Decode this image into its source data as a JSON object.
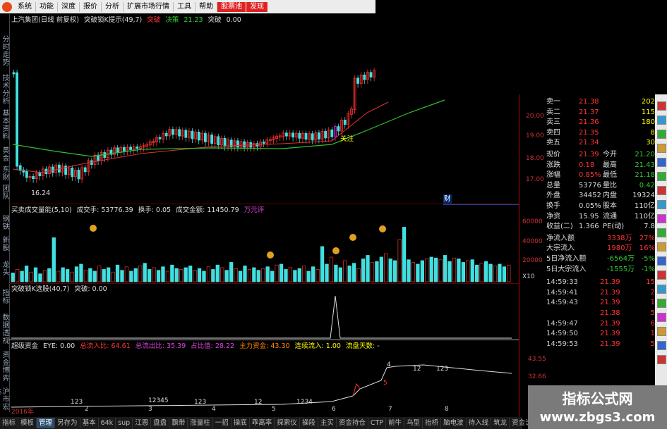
{
  "menu": {
    "items": [
      "系统",
      "功能",
      "深度",
      "报价",
      "分析",
      "扩展市场行情",
      "工具",
      "帮助",
      "股票池",
      "发现"
    ]
  },
  "left_tabs": [
    "分时走势",
    "技术分析",
    "基本资料",
    "黄金",
    "东财",
    "团队",
    "钢铁",
    "新股",
    "龙头",
    "指标",
    "数据透视",
    "资金博弈",
    "沪市宏达",
    "深"
  ],
  "kline": {
    "header": [
      "上汽集团(日线 前复权)",
      "突破锁K提示(49,7)",
      "突破",
      "决策",
      "21.23",
      "突破",
      "0.00"
    ],
    "low_label": "16.24",
    "mark_label": "关注",
    "y_ticks": [
      "20.00",
      "19.00",
      "18.00",
      "17.00"
    ],
    "colors": {
      "up": "#ff3030",
      "down": "#40e0e0",
      "ma_short": "#e03030",
      "ma_long": "#30c030",
      "magenta": "#d020d0"
    },
    "short_label": "财"
  },
  "volume": {
    "header": [
      "买卖成交量能(5,10)",
      "成交手: 53776.39",
      "换手: 0.05",
      "成交金额: 11450.79",
      "万元评"
    ],
    "y_ticks": [
      "60000",
      "40000",
      "20000"
    ],
    "unit": "X10",
    "values": [
      10,
      14,
      12,
      18,
      11,
      16,
      9,
      13,
      15,
      50,
      12,
      16,
      14,
      11,
      17,
      20,
      13,
      15,
      12,
      18,
      14,
      16,
      11,
      19,
      13,
      17,
      12,
      15,
      18,
      21,
      14,
      16,
      13,
      17,
      12,
      19,
      15,
      14,
      16,
      18,
      13,
      15,
      12,
      17,
      14,
      19,
      16,
      13,
      22,
      15,
      12,
      18,
      14,
      16,
      13,
      15,
      17,
      12,
      19,
      20,
      14,
      16,
      13,
      15,
      18,
      12,
      17,
      14,
      40,
      20,
      28,
      19,
      16,
      24,
      18,
      21,
      15,
      26,
      30,
      22,
      23,
      28,
      32,
      26,
      24,
      48,
      62,
      25,
      22,
      20,
      24,
      26,
      28,
      27,
      25,
      30,
      23,
      27,
      26,
      22,
      24,
      25,
      19,
      21,
      23,
      20,
      18,
      20,
      17,
      19
    ]
  },
  "signal": {
    "header": [
      "突破锁K选股(40,7)",
      "突破: 0.00"
    ]
  },
  "capital": {
    "header": [
      "超级资金",
      "EYE: 0.00",
      "总流入比: 64.61",
      "总流出比: 35.39",
      "占比值: 28.22",
      "主力资金: 43.30",
      "连续流入: 1.00",
      "流盘天数: -"
    ],
    "y_ticks": [
      "43.55",
      "32.66"
    ],
    "date_label": "2016年",
    "month_labels": [
      "2",
      "3",
      "4",
      "5",
      "6",
      "7",
      "8"
    ],
    "digit_labels": [
      "123",
      "12345",
      "123",
      "1234",
      "12",
      "123",
      "12",
      "4",
      "5"
    ]
  },
  "order_book": {
    "asks": [
      {
        "label": "卖一",
        "price": "21.38",
        "vol": "202"
      },
      {
        "label": "卖二",
        "price": "21.37",
        "vol": "115"
      },
      {
        "label": "卖三",
        "price": "21.36",
        "vol": "180"
      },
      {
        "label": "卖四",
        "price": "21.35",
        "vol": "8"
      },
      {
        "label": "卖五",
        "price": "21.34",
        "vol": "30"
      }
    ],
    "stats": [
      {
        "l1": "现价",
        "v1": "21.39",
        "l2": "今开",
        "v2": "21.20"
      },
      {
        "l1": "涨跌",
        "v1": "0.18",
        "l2": "最高",
        "v2": "21.43"
      },
      {
        "l1": "涨幅",
        "v1": "0.85%",
        "l2": "最低",
        "v2": "21.18"
      },
      {
        "l1": "总量",
        "v1": "53776",
        "l2": "量比",
        "v2": "0.42"
      },
      {
        "l1": "外盘",
        "v1": "34452",
        "l2": "内盘",
        "v2": "19324"
      },
      {
        "l1": "换手",
        "v1": "0.05%",
        "l2": "股本",
        "v2": "110亿"
      },
      {
        "l1": "净资",
        "v1": "15.95",
        "l2": "流通",
        "v2": "110亿"
      },
      {
        "l1": "收益(二)",
        "v1": "1.366",
        "l2": "PE(动)",
        "v2": "7.8"
      }
    ],
    "flows": [
      {
        "label": "净流入额",
        "value": "3338万",
        "pct": "27%"
      },
      {
        "label": "大宗流入",
        "value": "1980万",
        "pct": "16%"
      },
      {
        "label": "5日净流入额",
        "value": "-6564万",
        "pct": "-5%"
      },
      {
        "label": "5日大宗流入",
        "value": "-1555万",
        "pct": "-1%"
      }
    ],
    "ticks": [
      {
        "time": "14:59:33",
        "price": "21.39",
        "vol": "15"
      },
      {
        "time": "14:59:41",
        "price": "21.39",
        "vol": "2"
      },
      {
        "time": "14:59:43",
        "price": "21.39",
        "vol": "1"
      },
      {
        "time": "",
        "price": "21.38",
        "vol": "5"
      },
      {
        "time": "14:59:47",
        "price": "21.39",
        "vol": "6"
      },
      {
        "time": "14:59:50",
        "price": "21.39",
        "vol": "1"
      },
      {
        "time": "14:59:53",
        "price": "21.39",
        "vol": "5"
      }
    ]
  },
  "bottom_tabs": [
    "指标",
    "模板",
    "管理",
    "另存为",
    "基本",
    "64k",
    "sup",
    "江恩",
    "盘盘",
    "飘带",
    "涨量柱",
    "一招",
    "操底",
    "乖离率",
    "探索仪",
    "操段",
    "主买",
    "资金持仓",
    "CTP",
    "前牛",
    "乌型",
    "抬桥",
    "脑电波",
    "待入线",
    "筑龙",
    "资金流向",
    "资金",
    "宝宝",
    "A资金"
  ],
  "active_bottom_tab": "管理",
  "watermark": {
    "line1": "指标公式网",
    "line2": "www.zbgs3.com"
  }
}
